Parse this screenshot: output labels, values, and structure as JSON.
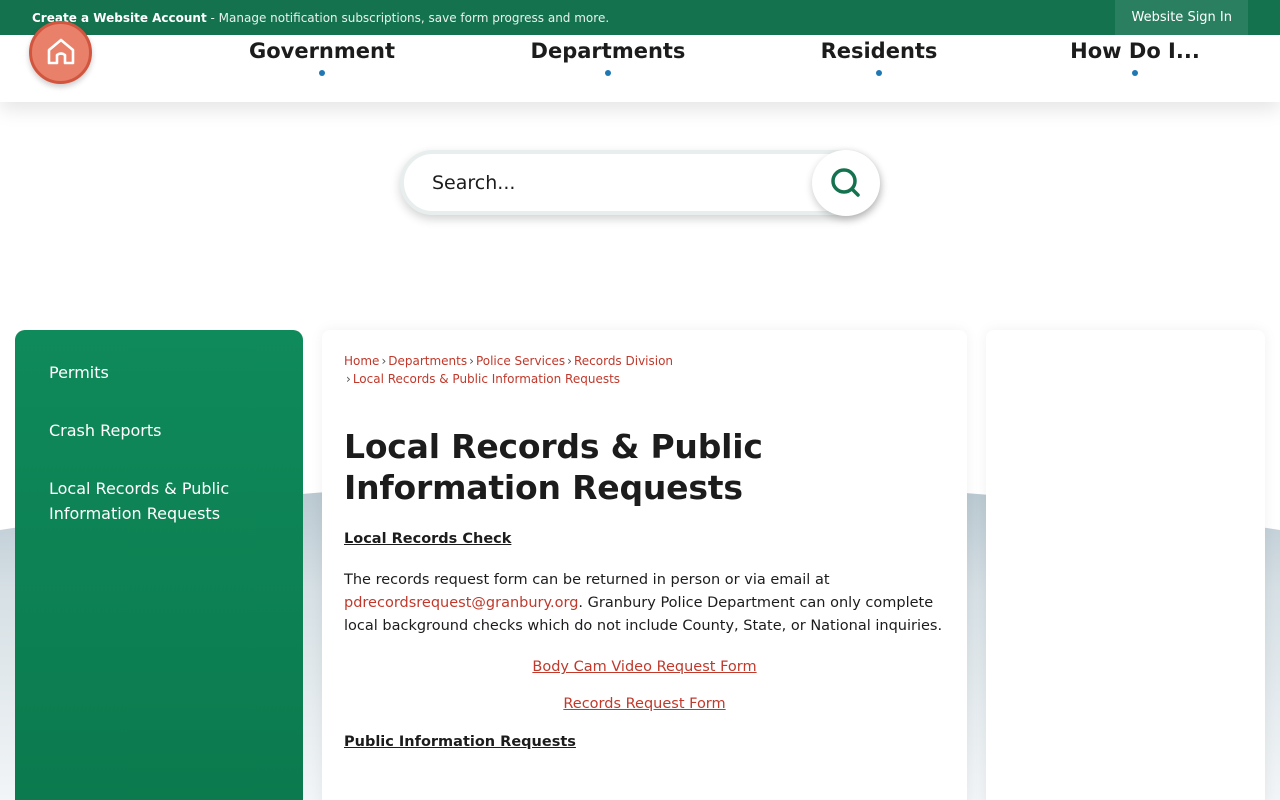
{
  "topbar": {
    "account_link": "Create a Website Account",
    "account_message": " - Manage notification subscriptions, save form progress and more.",
    "signin_label": "Website Sign In"
  },
  "nav": {
    "items": [
      {
        "label": "Government"
      },
      {
        "label": "Departments"
      },
      {
        "label": "Residents"
      },
      {
        "label": "How Do I..."
      }
    ]
  },
  "search": {
    "placeholder": "Search..."
  },
  "sidebar": {
    "items": [
      {
        "label": "Permits"
      },
      {
        "label": "Crash Reports"
      },
      {
        "label": "Local Records & Public Information Requests"
      }
    ]
  },
  "breadcrumb": {
    "items": [
      "Home",
      "Departments",
      "Police Services",
      "Records Division",
      "Local Records & Public Information Requests"
    ],
    "separator": "›"
  },
  "content": {
    "title": "Local Records & Public Information Requests",
    "section1_heading": "Local Records Check",
    "para1_before": "The records request form can be returned in person or via email at ",
    "para1_email": "pdrecordsrequest@granbury.org",
    "para1_after": ". Granbury Police Department can only complete local background checks which do not include County, State, or National inquiries.",
    "link_bodycam": "Body Cam Video Request Form",
    "link_records": "Records Request Form",
    "section2_heading": "Public Information Requests"
  },
  "colors": {
    "brand_green": "#14724f",
    "link_red": "#c0392b",
    "nav_dot": "#1f77b4"
  },
  "icons": {
    "home": "home-icon",
    "search": "search-icon"
  }
}
